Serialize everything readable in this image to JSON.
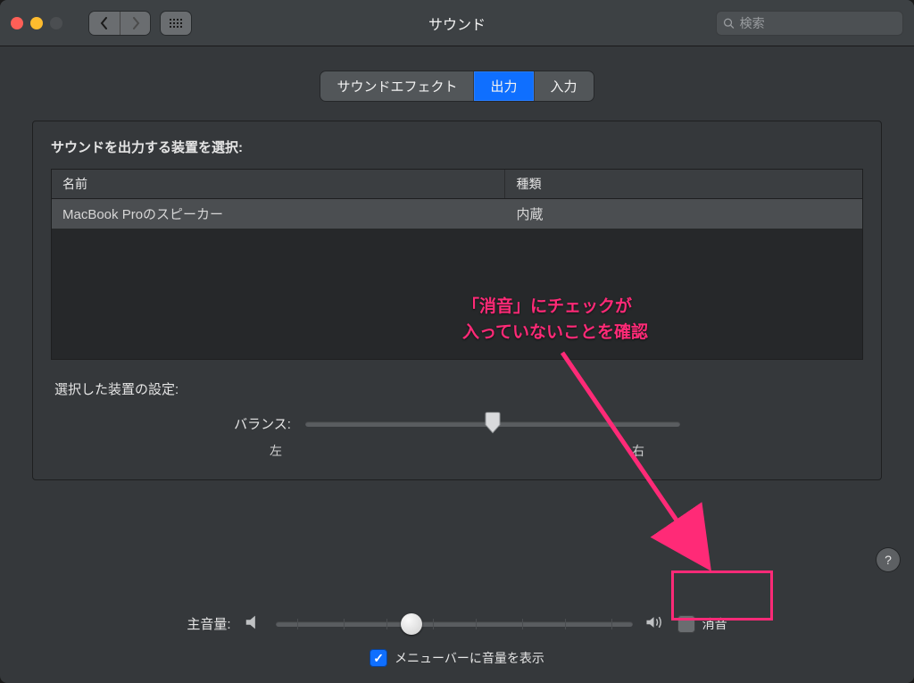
{
  "window": {
    "title": "サウンド"
  },
  "search": {
    "placeholder": "検索"
  },
  "tabs": {
    "effects": "サウンドエフェクト",
    "output": "出力",
    "input": "入力"
  },
  "panel": {
    "select_label": "サウンドを出力する装置を選択:",
    "col_name": "名前",
    "col_type": "種類",
    "device_name": "MacBook Proのスピーカー",
    "device_type": "内蔵",
    "settings_label": "選択した装置の設定:",
    "balance_label": "バランス:",
    "left": "左",
    "right": "右"
  },
  "footer": {
    "main_volume": "主音量:",
    "mute": "消音",
    "menubar": "メニューバーに音量を表示"
  },
  "annotation": {
    "line1": "「消音」にチェックが",
    "line2": "入っていないことを確認"
  },
  "help": "?"
}
